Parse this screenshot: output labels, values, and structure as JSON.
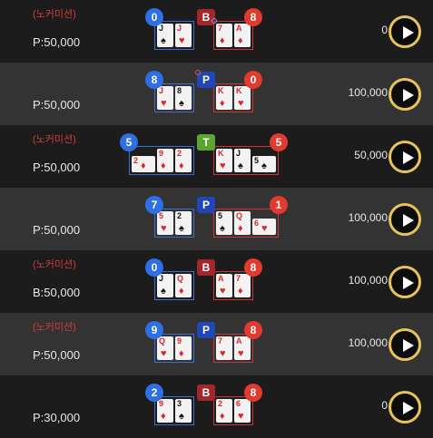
{
  "rows": [
    {
      "theme": "dark",
      "no_commission": "(노커미션)",
      "bet": "P:50,000",
      "amount": "0",
      "player_score": "0",
      "result": "B",
      "banker_score": "8",
      "marker": "blue",
      "player_cards": [
        {
          "rank": "J",
          "suit": "♠",
          "color": "black"
        },
        {
          "rank": "J",
          "suit": "♥",
          "color": "red"
        }
      ],
      "banker_cards": [
        {
          "rank": "7",
          "suit": "♦",
          "color": "red"
        },
        {
          "rank": "A",
          "suit": "♦",
          "color": "red"
        }
      ]
    },
    {
      "theme": "light",
      "no_commission": "",
      "bet": "P:50,000",
      "amount": "100,000",
      "player_score": "8",
      "result": "P",
      "banker_score": "0",
      "marker": "red",
      "player_cards": [
        {
          "rank": "J",
          "suit": "♥",
          "color": "red"
        },
        {
          "rank": "8",
          "suit": "♠",
          "color": "black"
        }
      ],
      "banker_cards": [
        {
          "rank": "K",
          "suit": "♦",
          "color": "red"
        },
        {
          "rank": "K",
          "suit": "♥",
          "color": "red"
        }
      ]
    },
    {
      "theme": "dark",
      "no_commission": "(노커미션)",
      "bet": "P:50,000",
      "amount": "50,000",
      "player_score": "5",
      "result": "T",
      "banker_score": "5",
      "marker": "",
      "player_cards": [
        {
          "rank": "2",
          "suit": "♦",
          "color": "red",
          "wide": true
        },
        {
          "rank": "9",
          "suit": "♦",
          "color": "red"
        },
        {
          "rank": "2",
          "suit": "♦",
          "color": "red"
        }
      ],
      "banker_cards": [
        {
          "rank": "K",
          "suit": "♥",
          "color": "red"
        },
        {
          "rank": "J",
          "suit": "♠",
          "color": "black"
        },
        {
          "rank": "5",
          "suit": "♠",
          "color": "black",
          "wide": true
        }
      ]
    },
    {
      "theme": "light",
      "no_commission": "",
      "bet": "P:50,000",
      "amount": "100,000",
      "player_score": "7",
      "result": "P",
      "banker_score": "1",
      "marker": "",
      "player_cards": [
        {
          "rank": "5",
          "suit": "♥",
          "color": "red"
        },
        {
          "rank": "2",
          "suit": "♠",
          "color": "black"
        }
      ],
      "banker_cards": [
        {
          "rank": "5",
          "suit": "♠",
          "color": "black"
        },
        {
          "rank": "Q",
          "suit": "♦",
          "color": "red"
        },
        {
          "rank": "6",
          "suit": "♥",
          "color": "red",
          "wide": true
        }
      ]
    },
    {
      "theme": "dark",
      "no_commission": "(노커미션)",
      "bet": "B:50,000",
      "amount": "100,000",
      "player_score": "0",
      "result": "B",
      "banker_score": "8",
      "marker": "",
      "player_cards": [
        {
          "rank": "J",
          "suit": "♠",
          "color": "black"
        },
        {
          "rank": "Q",
          "suit": "♦",
          "color": "red"
        }
      ],
      "banker_cards": [
        {
          "rank": "A",
          "suit": "♥",
          "color": "red"
        },
        {
          "rank": "7",
          "suit": "♦",
          "color": "red"
        }
      ]
    },
    {
      "theme": "light",
      "no_commission": "(노커미션)",
      "bet": "P:50,000",
      "amount": "100,000",
      "player_score": "9",
      "result": "P",
      "banker_score": "8",
      "marker": "",
      "player_cards": [
        {
          "rank": "Q",
          "suit": "♥",
          "color": "red"
        },
        {
          "rank": "9",
          "suit": "♦",
          "color": "red"
        }
      ],
      "banker_cards": [
        {
          "rank": "7",
          "suit": "♥",
          "color": "red"
        },
        {
          "rank": "A",
          "suit": "♥",
          "color": "red"
        }
      ]
    },
    {
      "theme": "dark",
      "no_commission": "",
      "bet": "P:30,000",
      "amount": "0",
      "player_score": "2",
      "result": "B",
      "banker_score": "8",
      "marker": "",
      "player_cards": [
        {
          "rank": "9",
          "suit": "♦",
          "color": "red"
        },
        {
          "rank": "3",
          "suit": "♠",
          "color": "black"
        }
      ],
      "banker_cards": [
        {
          "rank": "2",
          "suit": "♦",
          "color": "red"
        },
        {
          "rank": "6",
          "suit": "♥",
          "color": "red"
        }
      ]
    }
  ]
}
